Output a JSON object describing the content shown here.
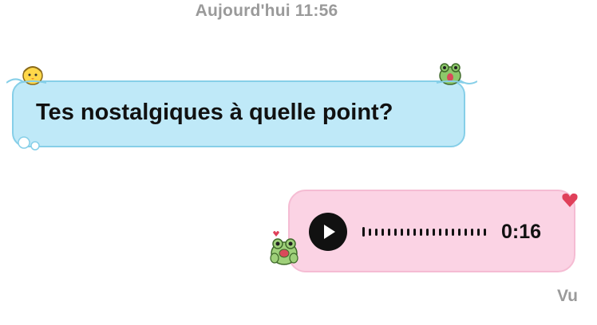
{
  "conversation": {
    "timestamp": "Aujourd'hui 11:56"
  },
  "incoming_message": {
    "text": "Tes nostalgiques à quelle point?",
    "bubble_color": "#bfe9f8",
    "decorations": [
      "chick-sticker-icon",
      "frog-sticker-icon",
      "water-bubbles-icon"
    ]
  },
  "outgoing_voice_message": {
    "duration": "0:16",
    "bubble_color": "#fbd3e4",
    "play_icon": "play-icon",
    "decorations": [
      "heart-icon",
      "frog-sticker-icon"
    ]
  },
  "status": {
    "read_receipt": "Vu"
  }
}
